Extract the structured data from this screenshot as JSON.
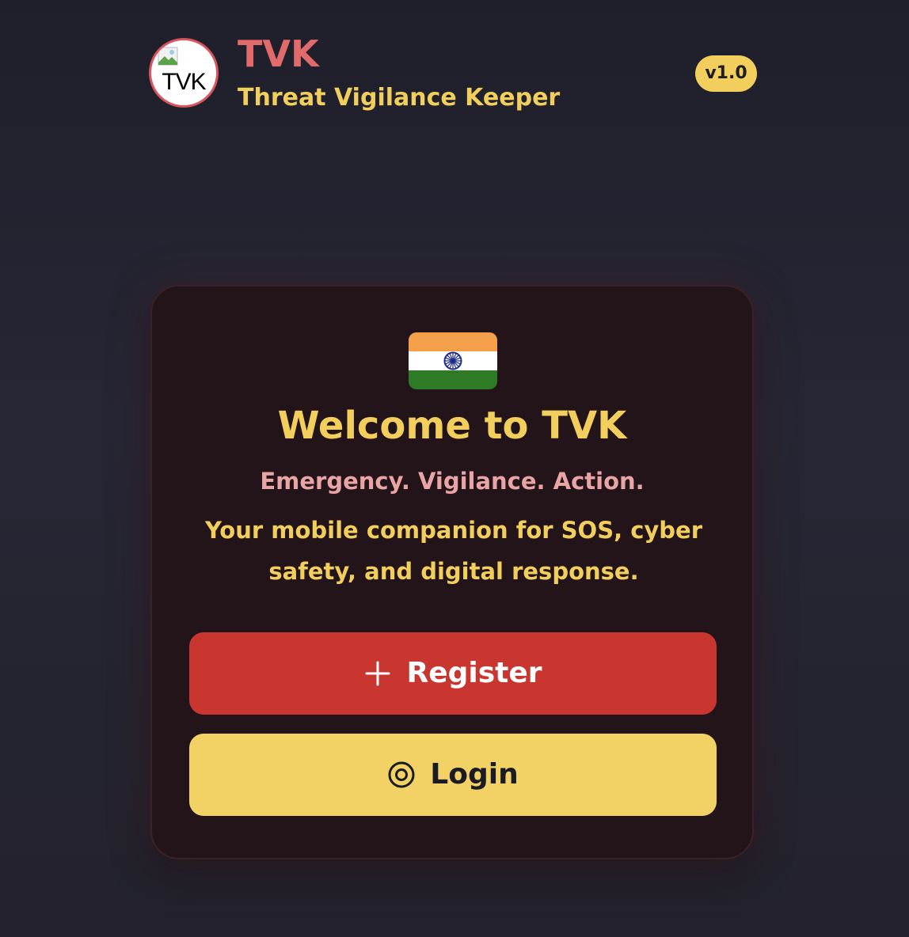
{
  "header": {
    "logo_text": "TVK",
    "title": "TVK",
    "subtitle": "Threat Vigilance Keeper",
    "version": "v1.0"
  },
  "card": {
    "flag_icon": "india-flag-icon",
    "welcome": "Welcome to TVK",
    "tagline": "Emergency. Vigilance. Action.",
    "description": "Your mobile companion for SOS, cyber safety, and digital response."
  },
  "buttons": {
    "register": {
      "label": "Register",
      "icon": "plus-icon"
    },
    "login": {
      "label": "Login",
      "icon": "target-icon"
    }
  },
  "colors": {
    "accent_red": "#e06b6a",
    "accent_yellow": "#f2cf5c",
    "register_bg": "#c9362f",
    "login_bg": "#f2d265",
    "card_bg": "#221419",
    "page_bg": "#23232f"
  }
}
